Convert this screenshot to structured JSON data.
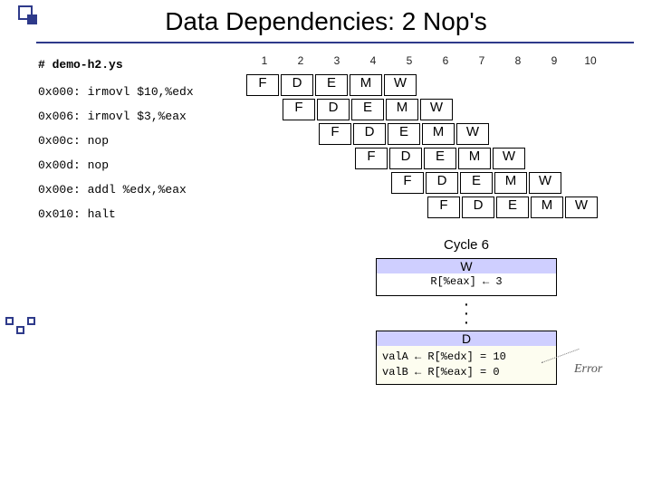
{
  "title": "Data Dependencies: 2 Nop's",
  "demo_label": "# demo-h2.ys",
  "code": [
    "0x000: irmovl $10,%edx",
    "0x006: irmovl  $3,%eax",
    "0x00c: nop",
    "0x00d: nop",
    "0x00e: addl  %edx,%eax",
    "0x010: halt"
  ],
  "cycles": [
    "1",
    "2",
    "3",
    "4",
    "5",
    "6",
    "7",
    "8",
    "9",
    "10"
  ],
  "pipe": [
    [
      "F",
      "D",
      "E",
      "M",
      "W",
      "",
      "",
      "",
      "",
      ""
    ],
    [
      "",
      "F",
      "D",
      "E",
      "M",
      "W",
      "",
      "",
      "",
      ""
    ],
    [
      "",
      "",
      "F",
      "D",
      "E",
      "M",
      "W",
      "",
      "",
      ""
    ],
    [
      "",
      "",
      "",
      "F",
      "D",
      "E",
      "M",
      "W",
      "",
      ""
    ],
    [
      "",
      "",
      "",
      "",
      "F",
      "D",
      "E",
      "M",
      "W",
      ""
    ],
    [
      "",
      "",
      "",
      "",
      "",
      "F",
      "D",
      "E",
      "M",
      "W"
    ]
  ],
  "detail": {
    "cycle_label": "Cycle 6",
    "w_stage": "W",
    "w_body": "R[%eax] ← 3",
    "d_stage": "D",
    "d_body1": "valA ←  R[%edx] = 10",
    "d_body2": "valB ←  R[%eax] = 0"
  },
  "error_label": "Error"
}
